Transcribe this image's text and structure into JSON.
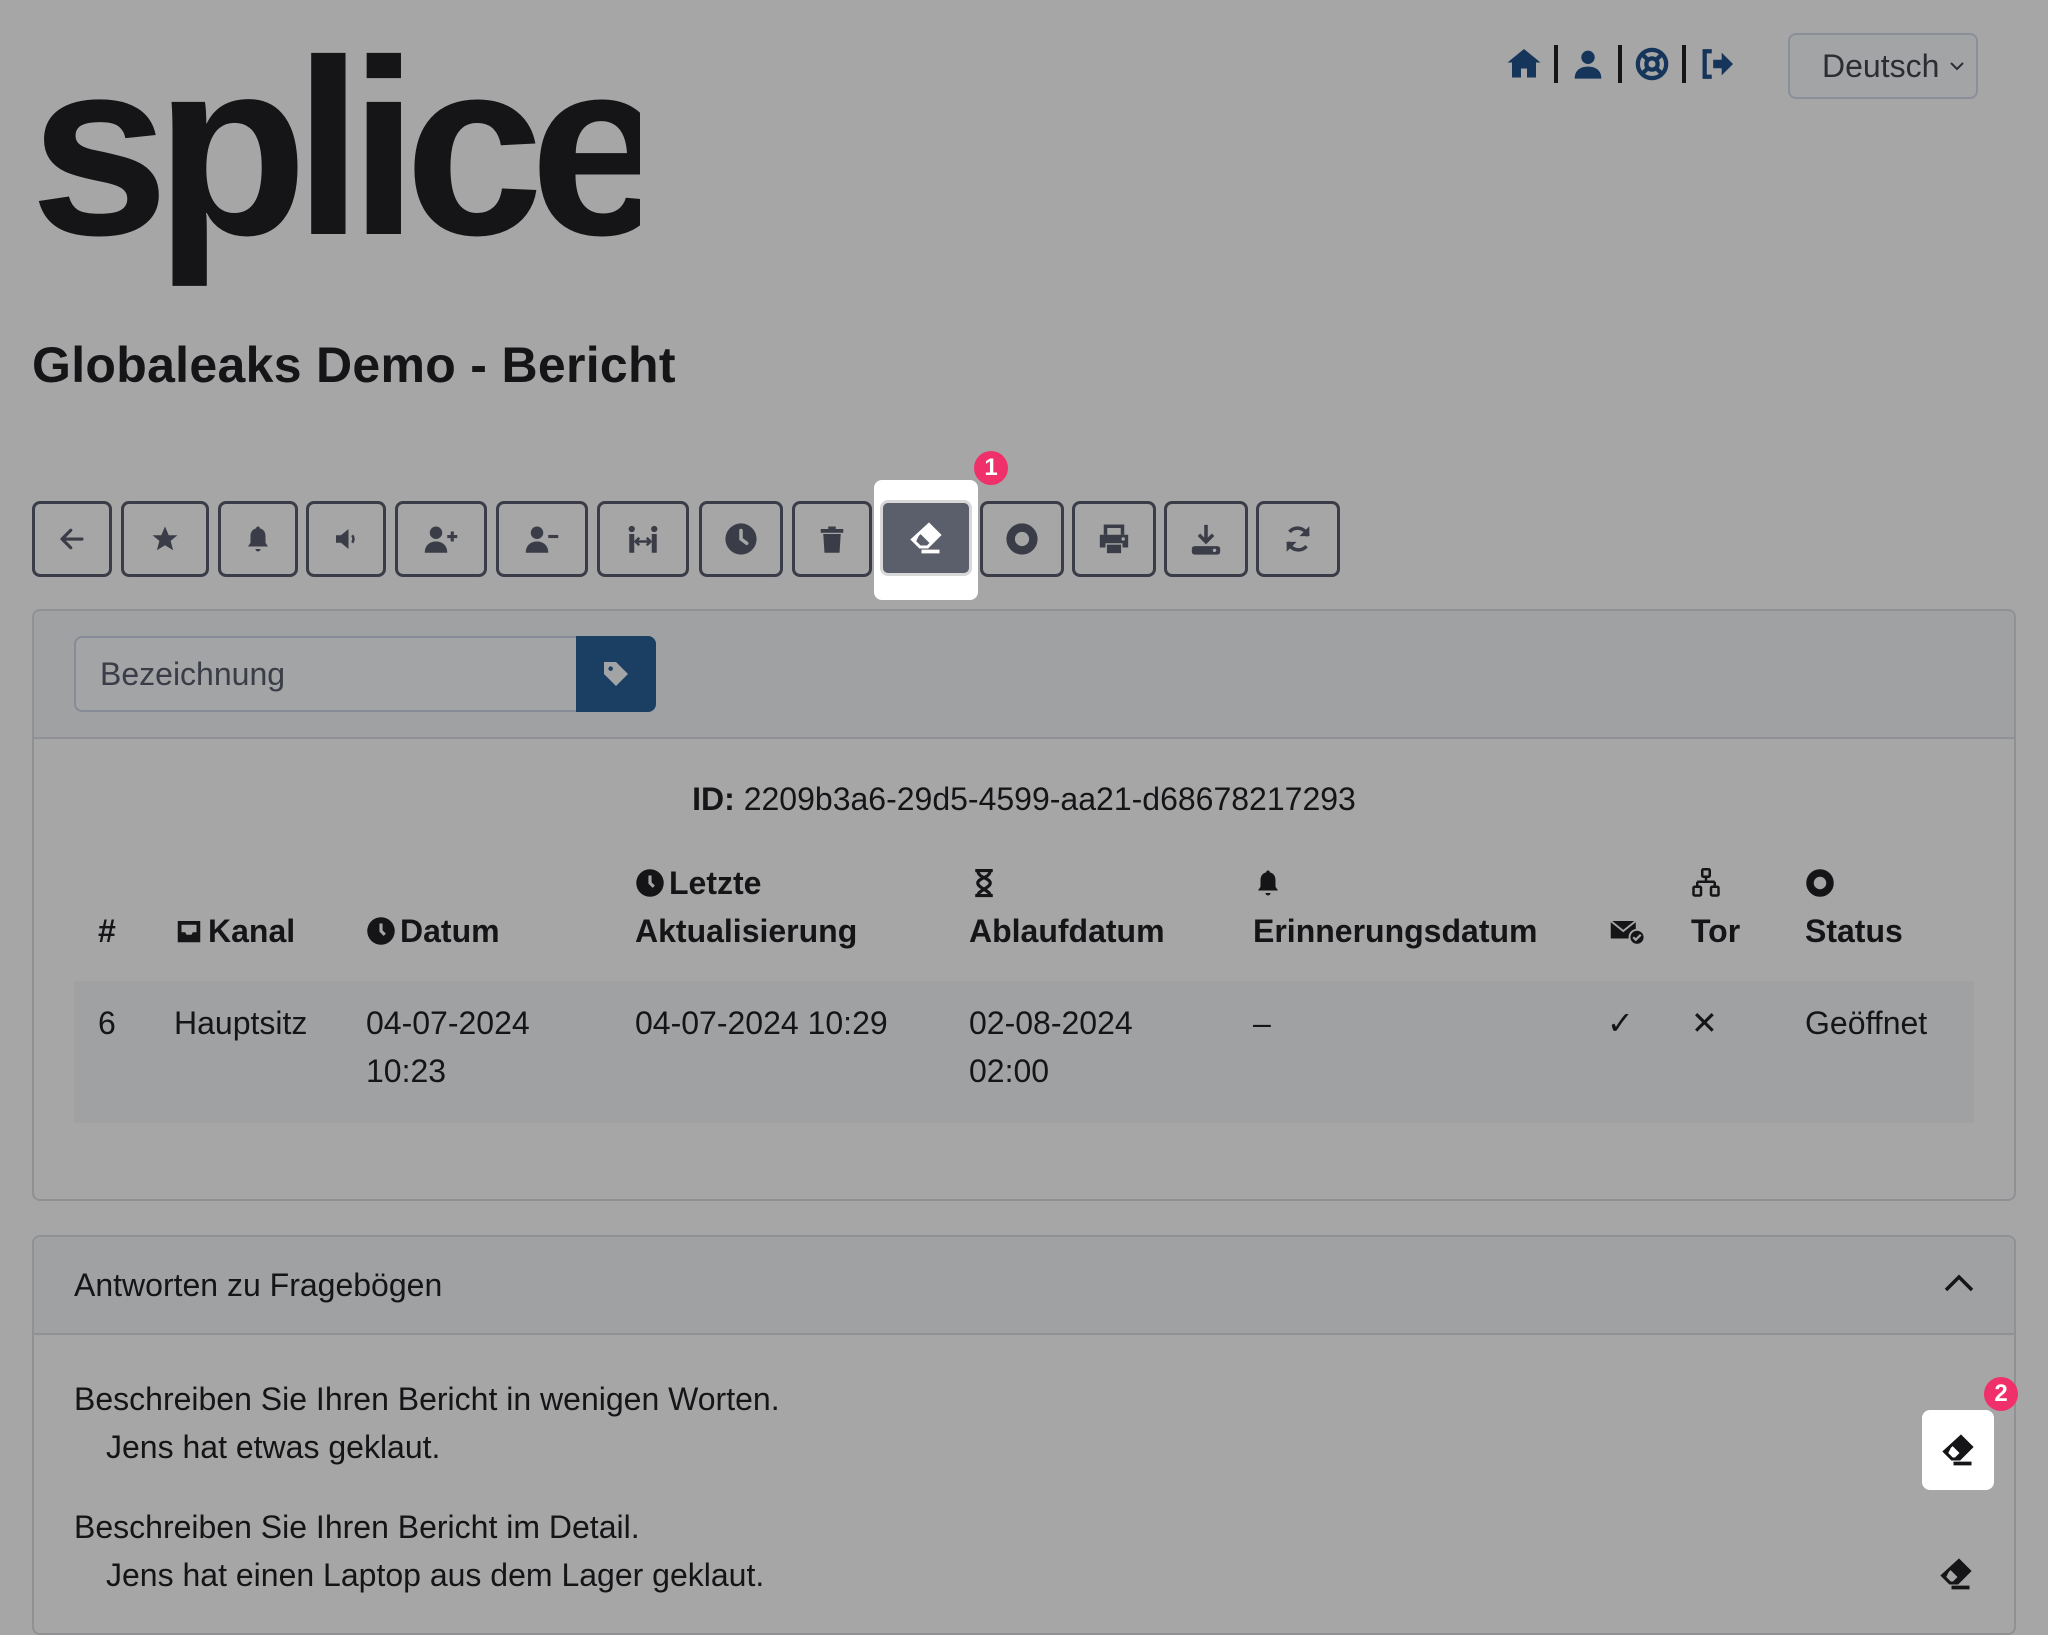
{
  "brand": {
    "logo_text": "splice"
  },
  "topnav": {
    "icons": [
      "home-icon",
      "user-icon",
      "support-icon",
      "logout-icon"
    ],
    "language": {
      "selected": "Deutsch"
    }
  },
  "page": {
    "title": "Globaleaks Demo - Bericht"
  },
  "toolbar": {
    "buttons": [
      {
        "name": "back",
        "icon": "arrow-left-icon"
      },
      {
        "name": "important",
        "icon": "star-icon"
      },
      {
        "name": "reminder",
        "icon": "bell-icon"
      },
      {
        "name": "silence",
        "icon": "volume-off-icon"
      },
      {
        "name": "grant-access",
        "icon": "user-plus-icon"
      },
      {
        "name": "revoke-access",
        "icon": "user-minus-icon"
      },
      {
        "name": "transfer",
        "icon": "people-arrows-icon"
      },
      {
        "name": "postpone",
        "icon": "clock-icon"
      },
      {
        "name": "delete",
        "icon": "trash-icon"
      },
      {
        "name": "mask",
        "icon": "eraser-icon",
        "active": true
      },
      {
        "name": "status",
        "icon": "circle-dot-icon"
      },
      {
        "name": "print",
        "icon": "print-icon"
      },
      {
        "name": "export",
        "icon": "download-icon"
      },
      {
        "name": "reload",
        "icon": "refresh-icon"
      }
    ],
    "badge_1": "1"
  },
  "label_form": {
    "placeholder": "Bezeichnung",
    "value": ""
  },
  "report": {
    "id_label": "ID:",
    "id_value": "2209b3a6-29d5-4599-aa21-d68678217293",
    "columns": [
      {
        "key": "num",
        "label": "#",
        "icon": null
      },
      {
        "key": "channel",
        "label": "Kanal",
        "icon": "inbox-icon"
      },
      {
        "key": "date",
        "label": "Datum",
        "icon": "clock-icon"
      },
      {
        "key": "updated",
        "label": "Letzte Aktualisierung",
        "icon": "clock-icon"
      },
      {
        "key": "expiry",
        "label": "Ablaufdatum",
        "icon": "hourglass-icon"
      },
      {
        "key": "reminder",
        "label": "Erinnerungsdatum",
        "icon": "bell-icon"
      },
      {
        "key": "notified",
        "label": "",
        "icon": "envelope-check-icon"
      },
      {
        "key": "tor",
        "label": "Tor",
        "icon": "network-icon"
      },
      {
        "key": "status",
        "label": "Status",
        "icon": "circle-dot-icon"
      }
    ],
    "row": {
      "num": "6",
      "channel": "Hauptsitz",
      "date": "04-07-2024 10:23",
      "updated": "04-07-2024 10:29",
      "expiry": "02-08-2024 02:00",
      "reminder": "–",
      "notified": "✓",
      "tor": "✕",
      "status": "Geöffnet"
    }
  },
  "questionnaire": {
    "title": "Antworten zu Fragebögen",
    "items": [
      {
        "question": "Beschreiben Sie Ihren Bericht in wenigen Worten.",
        "answer": "Jens hat etwas geklaut."
      },
      {
        "question": "Beschreiben Sie Ihren Bericht im Detail.",
        "answer": "Jens hat einen Laptop aus dem Lager geklaut."
      }
    ],
    "badge_2": "2"
  },
  "colors": {
    "accent": "#1b3e63",
    "badge": "#f0306a",
    "overlay": "#a6a6a6"
  }
}
